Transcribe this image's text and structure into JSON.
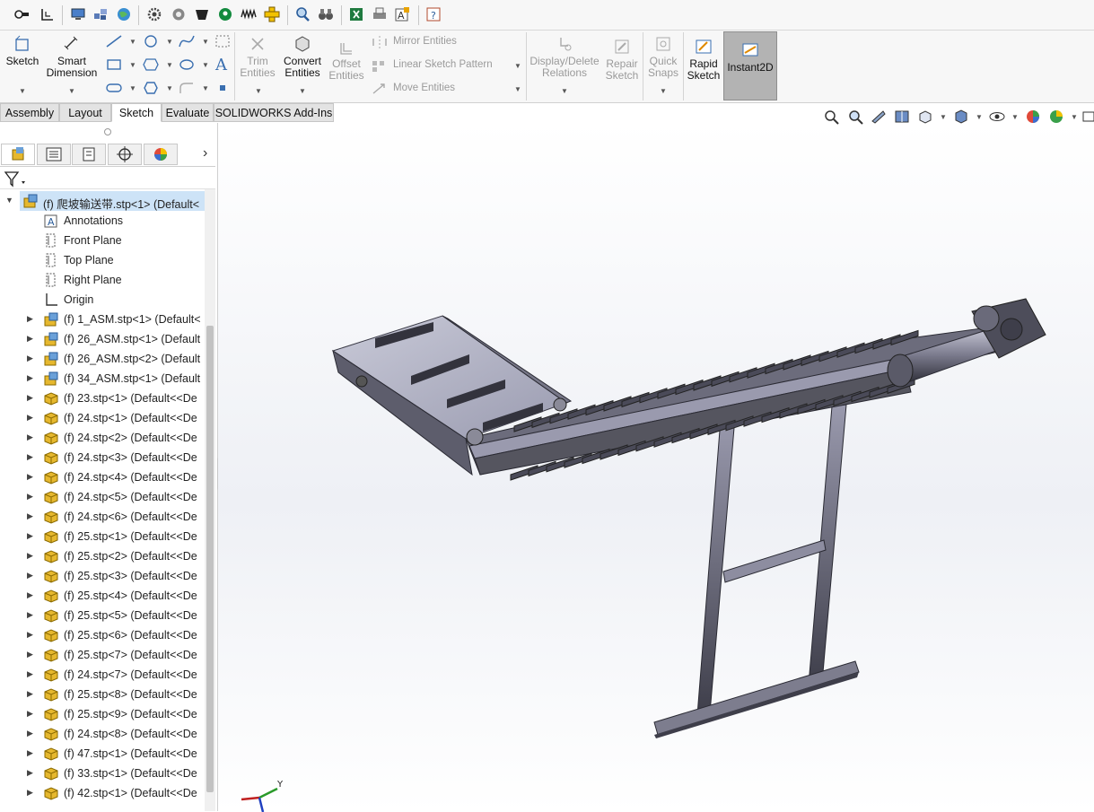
{
  "toolbar_icons": [
    "search-options-icon",
    "sketch-view-icon",
    "monitor-icon",
    "assembly-icon",
    "globe-icon",
    "gear-icon",
    "settings-icon",
    "cup-icon",
    "location-icon",
    "wave-icon",
    "move-icon",
    "zoom-icon",
    "binoculars-icon",
    "excel-icon",
    "print-icon",
    "text-edit-icon",
    "help-icon"
  ],
  "ribbon": {
    "sketch": "Sketch",
    "smart_dimension": [
      "Smart",
      "Dimension"
    ],
    "trim_entities": [
      "Trim",
      "Entities"
    ],
    "convert_entities": [
      "Convert",
      "Entities"
    ],
    "offset_entities": [
      "Offset",
      "Entities"
    ],
    "mirror_entities": "Mirror Entities",
    "linear_sketch_pattern": "Linear Sketch Pattern",
    "move_entities": "Move Entities",
    "display_delete_relations": [
      "Display/Delete",
      "Relations"
    ],
    "repair_sketch": [
      "Repair",
      "Sketch"
    ],
    "quick_snaps": [
      "Quick",
      "Snaps"
    ],
    "rapid_sketch": [
      "Rapid",
      "Sketch"
    ],
    "instant2d": "Instant2D"
  },
  "tabs": [
    "Assembly",
    "Layout",
    "Sketch",
    "Evaluate",
    "SOLIDWORKS Add-Ins"
  ],
  "active_tab": "Sketch",
  "tree": {
    "root": "(f) 爬坡输送带.stp<1> (Default<",
    "items": [
      {
        "label": "Annotations",
        "icon": "annotation-icon",
        "expand": false,
        "indent": 1
      },
      {
        "label": "Front Plane",
        "icon": "plane-icon",
        "expand": false,
        "indent": 1
      },
      {
        "label": "Top Plane",
        "icon": "plane-icon",
        "expand": false,
        "indent": 1
      },
      {
        "label": "Right Plane",
        "icon": "plane-icon",
        "expand": false,
        "indent": 1
      },
      {
        "label": "Origin",
        "icon": "origin-icon",
        "expand": false,
        "indent": 1
      },
      {
        "label": "(f) 1_ASM.stp<1> (Default<",
        "icon": "assembly-icon",
        "expand": true
      },
      {
        "label": "(f) 26_ASM.stp<1> (Default",
        "icon": "assembly-icon",
        "expand": true
      },
      {
        "label": "(f) 26_ASM.stp<2> (Default",
        "icon": "assembly-icon",
        "expand": true
      },
      {
        "label": "(f) 34_ASM.stp<1> (Default",
        "icon": "assembly-icon",
        "expand": true
      },
      {
        "label": "(f) 23.stp<1> (Default<<De",
        "icon": "part-icon",
        "expand": true
      },
      {
        "label": "(f) 24.stp<1> (Default<<De",
        "icon": "part-icon",
        "expand": true
      },
      {
        "label": "(f) 24.stp<2> (Default<<De",
        "icon": "part-icon",
        "expand": true
      },
      {
        "label": "(f) 24.stp<3> (Default<<De",
        "icon": "part-icon",
        "expand": true
      },
      {
        "label": "(f) 24.stp<4> (Default<<De",
        "icon": "part-icon",
        "expand": true
      },
      {
        "label": "(f) 24.stp<5> (Default<<De",
        "icon": "part-icon",
        "expand": true
      },
      {
        "label": "(f) 24.stp<6> (Default<<De",
        "icon": "part-icon",
        "expand": true
      },
      {
        "label": "(f) 25.stp<1> (Default<<De",
        "icon": "part-icon",
        "expand": true
      },
      {
        "label": "(f) 25.stp<2> (Default<<De",
        "icon": "part-icon",
        "expand": true
      },
      {
        "label": "(f) 25.stp<3> (Default<<De",
        "icon": "part-icon",
        "expand": true
      },
      {
        "label": "(f) 25.stp<4> (Default<<De",
        "icon": "part-icon",
        "expand": true
      },
      {
        "label": "(f) 25.stp<5> (Default<<De",
        "icon": "part-icon",
        "expand": true
      },
      {
        "label": "(f) 25.stp<6> (Default<<De",
        "icon": "part-icon",
        "expand": true
      },
      {
        "label": "(f) 25.stp<7> (Default<<De",
        "icon": "part-icon",
        "expand": true
      },
      {
        "label": "(f) 24.stp<7> (Default<<De",
        "icon": "part-icon",
        "expand": true
      },
      {
        "label": "(f) 25.stp<8> (Default<<De",
        "icon": "part-icon",
        "expand": true
      },
      {
        "label": "(f) 25.stp<9> (Default<<De",
        "icon": "part-icon",
        "expand": true
      },
      {
        "label": "(f) 24.stp<8> (Default<<De",
        "icon": "part-icon",
        "expand": true
      },
      {
        "label": "(f) 47.stp<1> (Default<<De",
        "icon": "part-icon",
        "expand": true
      },
      {
        "label": "(f) 33.stp<1> (Default<<De",
        "icon": "part-icon",
        "expand": true
      },
      {
        "label": "(f) 42.stp<1> (Default<<De",
        "icon": "part-icon",
        "expand": true
      }
    ]
  },
  "triad": {
    "y_label": "Y"
  },
  "colors": {
    "part_yellow": "#e6b82e",
    "selection_blue": "#cde3f7",
    "model_metal": "#6a6a78"
  }
}
